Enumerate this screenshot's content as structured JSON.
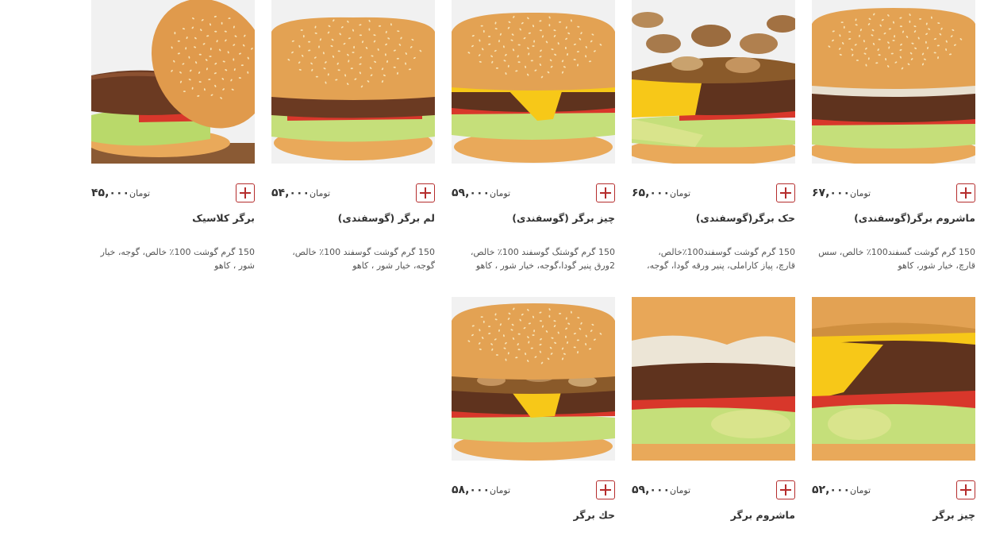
{
  "currency": "تومان",
  "products": [
    {
      "title": "ماشروم برگر(گوسفندی)",
      "price": "۶۷,۰۰۰",
      "desc_lines": [
        "150 گرم گوشت گسفند100٪ خالص، سس",
        "قارچ، خیار شور، کاهو"
      ],
      "image": "burger-mushroom-sauce"
    },
    {
      "title": "حک برگر(گوسفندی)",
      "price": "۶۵,۰۰۰",
      "desc_lines": [
        "150 گرم گوشت گوسفند100٪خالص،",
        "قارچ، پیاز کاراملی، پنیر ورقه گودا، گوجه،"
      ],
      "image": "burger-caramelized-mushroom"
    },
    {
      "title": "چیز برگر (گوسفندی)",
      "price": "۵۹,۰۰۰",
      "desc_lines": [
        "150 گرم گوشتگ گوسفند 100٪ خالص،",
        "2ورق پنیر گودا،گوجه، خیار شور ، کاهو"
      ],
      "image": "burger-cheese"
    },
    {
      "title": "لم برگر (گوسفندی)",
      "price": "۵۴,۰۰۰",
      "desc_lines": [
        "150 گرم گوشت گوسفند 100٪ خالص،",
        "گوجه، خیار شور ، کاهو"
      ],
      "image": "burger-lamb"
    },
    {
      "title": "برگر کلاسیک",
      "price": "۴۵,۰۰۰",
      "desc_lines": [
        "150 گرم گوشت 100٪ خالص، گوجه، خیار",
        "شور ، کاهو"
      ],
      "image": "burger-classic-open"
    },
    {
      "title": "چیز برگر",
      "price": "۵۲,۰۰۰",
      "desc_lines": [],
      "image": "burger-cheese-closeup"
    },
    {
      "title": "ماشروم برگر",
      "price": "۵۹,۰۰۰",
      "desc_lines": [],
      "image": "burger-mushroom-closeup"
    },
    {
      "title": "حك برگر",
      "price": "۵۸,۰۰۰",
      "desc_lines": [],
      "image": "burger-caramelized-full"
    }
  ],
  "colors": {
    "accent": "#b52d2d",
    "bun": "#e3a253",
    "patty": "#6b3a22",
    "cheese": "#f7c818",
    "lettuce": "#b9d96a",
    "tomato": "#d8372b"
  }
}
